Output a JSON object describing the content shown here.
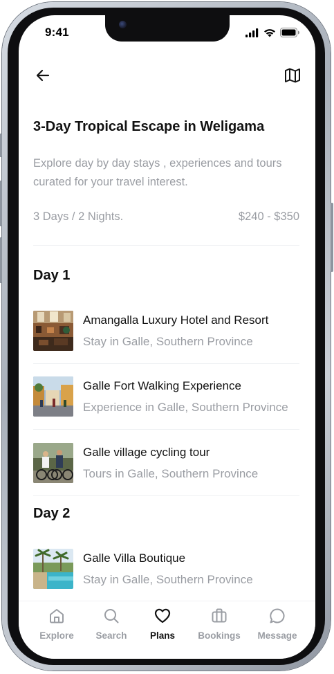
{
  "status_bar": {
    "time": "9:41"
  },
  "header": {
    "back_icon": "arrow-left-icon",
    "map_icon": "map-icon"
  },
  "plan": {
    "title": "3-Day Tropical Escape in Weligama",
    "description": "Explore day by day stays , experiences and tours curated for your travel interest.",
    "duration": "3 Days / 2 Nights.",
    "price_range": "$240 - $350"
  },
  "days": [
    {
      "label": "Day 1",
      "items": [
        {
          "title": "Amangalla Luxury Hotel and Resort",
          "subtitle": "Stay in Galle, Southern Province"
        },
        {
          "title": "Galle Fort Walking Experience",
          "subtitle": "Experience in Galle, Southern Province"
        },
        {
          "title": "Galle village cycling tour",
          "subtitle": "Tours in Galle, Southern Province"
        }
      ]
    },
    {
      "label": "Day 2",
      "items": [
        {
          "title": "Galle Villa Boutique",
          "subtitle": "Stay in Galle, Southern Province"
        }
      ]
    }
  ],
  "tabbar": {
    "tabs": [
      {
        "label": "Explore",
        "icon": "home-icon",
        "active": false
      },
      {
        "label": "Search",
        "icon": "search-icon",
        "active": false
      },
      {
        "label": "Plans",
        "icon": "heart-icon",
        "active": true
      },
      {
        "label": "Bookings",
        "icon": "briefcase-icon",
        "active": false
      },
      {
        "label": "Message",
        "icon": "chat-bubble-icon",
        "active": false
      }
    ]
  },
  "colors": {
    "text_primary": "#111111",
    "text_secondary": "#9a9da3",
    "divider": "#eef0f3"
  }
}
